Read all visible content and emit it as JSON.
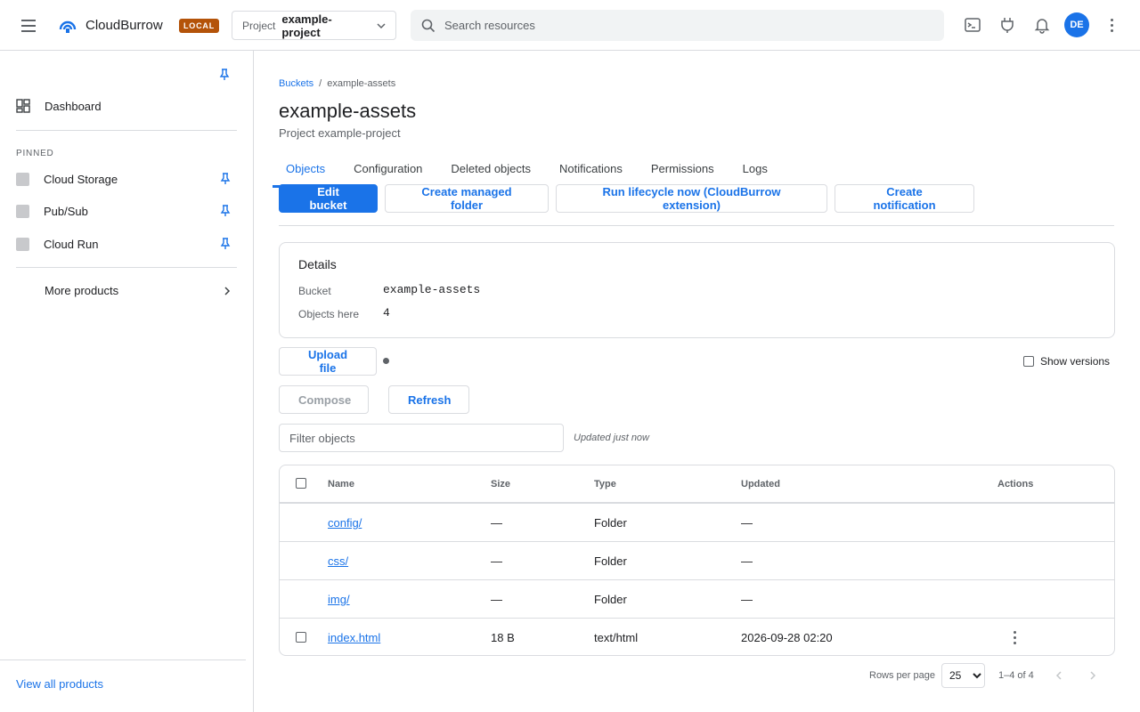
{
  "header": {
    "brand": "CloudBurrow",
    "badge": "LOCAL",
    "project_label": "Project",
    "project_value": "example-project",
    "search_placeholder": "Search resources",
    "avatar_initials": "DE",
    "icons": [
      "menu-icon",
      "cloud-logo-icon",
      "chevron-down-icon",
      "search-icon",
      "terminal-icon",
      "plug-icon",
      "bell-icon",
      "more-vert-icon"
    ]
  },
  "sidebar": {
    "dashboard": "Dashboard",
    "pinned_heading": "PINNED",
    "pinned_items": [
      {
        "label": "Cloud Storage"
      },
      {
        "label": "Pub/Sub"
      },
      {
        "label": "Cloud Run"
      }
    ],
    "more_products": "More products",
    "view_all": "View all products"
  },
  "main": {
    "breadcrumb": {
      "parent": "Buckets",
      "separator": "/",
      "current": "example-assets"
    },
    "title": "example-assets",
    "subtitle": "Project example-project",
    "tabs": [
      {
        "label": "Objects",
        "active": true
      },
      {
        "label": "Configuration"
      },
      {
        "label": "Deleted objects"
      },
      {
        "label": "Notifications"
      },
      {
        "label": "Permissions"
      },
      {
        "label": "Logs"
      }
    ],
    "actions": {
      "edit_bucket": "Edit bucket",
      "create_managed_folder": "Create managed folder",
      "run_lifecycle": "Run lifecycle now (CloudBurrow extension)",
      "create_notification": "Create notification"
    },
    "details": {
      "title": "Details",
      "bucket_label": "Bucket",
      "bucket_value": "example-assets",
      "objects_label": "Objects here",
      "objects_value": "4"
    },
    "upload_file": "Upload file",
    "show_versions": "Show versions",
    "compose": "Compose",
    "refresh": "Refresh",
    "filter_placeholder": "Filter objects",
    "updated_note": "Updated just now",
    "table": {
      "columns": [
        "Name",
        "Size",
        "Type",
        "Updated",
        "Actions"
      ],
      "rows": [
        {
          "name": "config/",
          "size": "—",
          "type": "Folder",
          "updated": "—"
        },
        {
          "name": "css/",
          "size": "—",
          "type": "Folder",
          "updated": "—"
        },
        {
          "name": "img/",
          "size": "—",
          "type": "Folder",
          "updated": "—"
        },
        {
          "name": "index.html",
          "size": "18 B",
          "type": "text/html",
          "updated": "2026-09-28 02:20"
        }
      ]
    },
    "pagination": {
      "rows_per_page_label": "Rows per page",
      "rows_per_page_value": "25",
      "range": "1–4 of 4"
    }
  },
  "colors": {
    "accent": "#1a73e8",
    "badge": "#b45309",
    "border": "#dadce0"
  }
}
